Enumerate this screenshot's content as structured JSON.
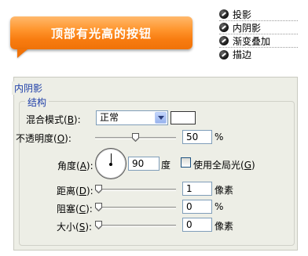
{
  "button_demo": {
    "label": "顶部有光高的按钮"
  },
  "layer_styles": [
    {
      "label": "投影"
    },
    {
      "label": "内阴影"
    },
    {
      "label": "渐变叠加"
    },
    {
      "label": "描边"
    }
  ],
  "panel": {
    "title": "内阴影",
    "group_title": "结构",
    "blend_mode": {
      "label": "混合模式(",
      "key": "B",
      "suffix": "):",
      "value": "正常",
      "color": "#ffffff"
    },
    "opacity": {
      "label": "不透明度(",
      "key": "O",
      "suffix": "):",
      "value": "50",
      "unit": "%",
      "level": 0.5
    },
    "angle": {
      "label": "角度(",
      "key": "A",
      "suffix": "):",
      "value": "90",
      "unit": "度"
    },
    "global_light": {
      "label": "使用全局光(",
      "key": "G",
      "suffix": ")",
      "checked": false
    },
    "distance": {
      "label": "距离(",
      "key": "D",
      "suffix": "):",
      "value": "1",
      "unit": "像素",
      "level": 0.0
    },
    "choke": {
      "label": "阻塞(",
      "key": "C",
      "suffix": "):",
      "value": "0",
      "unit": "%",
      "level": 0.0
    },
    "size": {
      "label": "大小(",
      "key": "S",
      "suffix": "):",
      "value": "0",
      "unit": "像素",
      "level": 0.0
    }
  },
  "icons": {
    "layer_style": "fx-icon",
    "dropdown": "chevron-down-icon"
  },
  "colors": {
    "button_orange": "#f87c10",
    "legend_blue": "#1f3fa8",
    "panel_bg": "#edeee6"
  }
}
